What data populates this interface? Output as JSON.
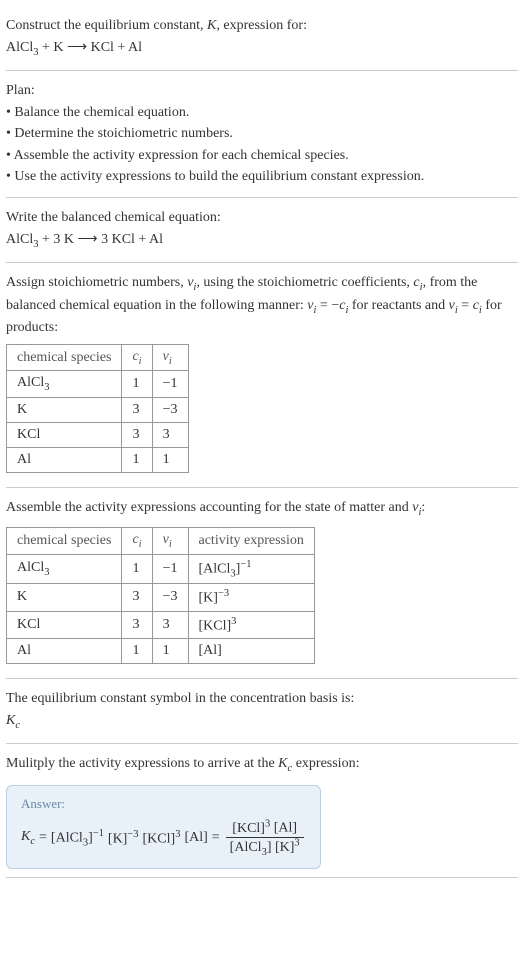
{
  "section1": {
    "prompt": "Construct the equilibrium constant, ",
    "prompt2": ", expression for:",
    "reaction_lhs1": "AlCl",
    "reaction_lhs1_sub": "3",
    "plus1": " + K ",
    "arrow": "⟶",
    "reaction_rhs": " KCl + Al"
  },
  "section2": {
    "title": "Plan:",
    "b1": "• Balance the chemical equation.",
    "b2": "• Determine the stoichiometric numbers.",
    "b3": "• Assemble the activity expression for each chemical species.",
    "b4": "• Use the activity expressions to build the equilibrium constant expression."
  },
  "section3": {
    "title": "Write the balanced chemical equation:",
    "lhs1": "AlCl",
    "lhs1_sub": "3",
    "mid": " + 3 K ",
    "arrow": "⟶",
    "rhs": " 3 KCl + Al"
  },
  "section4": {
    "p1a": "Assign stoichiometric numbers, ",
    "p1b": ", using the stoichiometric coefficients, ",
    "p1c": ", from the balanced chemical equation in the following manner: ",
    "p1d": " for reactants and ",
    "p1e": " for products:",
    "nu": "ν",
    "nui": "i",
    "c": "c",
    "ci": "i",
    "eq1a": "ν",
    "eq1b": " = −",
    "eq2a": "ν",
    "eq2b": " = ",
    "table": {
      "h1": "chemical species",
      "h2": "c",
      "h2i": "i",
      "h3": "ν",
      "h3i": "i",
      "rows": [
        {
          "sp": "AlCl",
          "sub": "3",
          "c": "1",
          "nu": "−1"
        },
        {
          "sp": "K",
          "sub": "",
          "c": "3",
          "nu": "−3"
        },
        {
          "sp": "KCl",
          "sub": "",
          "c": "3",
          "nu": "3"
        },
        {
          "sp": "Al",
          "sub": "",
          "c": "1",
          "nu": "1"
        }
      ]
    }
  },
  "section5": {
    "title_a": "Assemble the activity expressions accounting for the state of matter and ",
    "title_b": ":",
    "table": {
      "h1": "chemical species",
      "h2": "c",
      "h2i": "i",
      "h3": "ν",
      "h3i": "i",
      "h4": "activity expression",
      "rows": [
        {
          "sp": "AlCl",
          "sub": "3",
          "c": "1",
          "nu": "−1",
          "act_base": "[AlCl",
          "act_sub": "3",
          "act_close": "]",
          "act_sup": "−1"
        },
        {
          "sp": "K",
          "sub": "",
          "c": "3",
          "nu": "−3",
          "act_base": "[K]",
          "act_sub": "",
          "act_close": "",
          "act_sup": "−3"
        },
        {
          "sp": "KCl",
          "sub": "",
          "c": "3",
          "nu": "3",
          "act_base": "[KCl]",
          "act_sub": "",
          "act_close": "",
          "act_sup": "3"
        },
        {
          "sp": "Al",
          "sub": "",
          "c": "1",
          "nu": "1",
          "act_base": "[Al]",
          "act_sub": "",
          "act_close": "",
          "act_sup": ""
        }
      ]
    }
  },
  "section6": {
    "title": "The equilibrium constant symbol in the concentration basis is:",
    "sym": "K",
    "symsub": "c"
  },
  "section7": {
    "title_a": "Mulitply the activity expressions to arrive at the ",
    "title_b": " expression:",
    "kc": "K",
    "kcsub": "c",
    "answer_label": "Answer:",
    "eq_lhs_k": "K",
    "eq_lhs_ksub": "c",
    "eq_eq": " = ",
    "t1_base": "[AlCl",
    "t1_sub": "3",
    "t1_close": "]",
    "t1_sup": "−1",
    "t2_base": "[K]",
    "t2_sup": "−3",
    "t3_base": "[KCl]",
    "t3_sup": "3",
    "t4_base": "[Al]",
    "eq_eq2": " = ",
    "num1_base": "[KCl]",
    "num1_sup": "3",
    "num2_base": "[Al]",
    "den1_base": "[AlCl",
    "den1_sub": "3",
    "den1_close": "]",
    "den2_base": "[K]",
    "den2_sup": "3"
  }
}
